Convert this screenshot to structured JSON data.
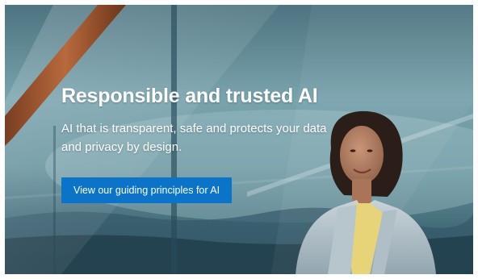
{
  "hero": {
    "headline": "Responsible and trusted AI",
    "subtitle": "AI that is transparent, safe and protects your data and privacy by design.",
    "cta_label": "View our guiding principles for AI"
  },
  "colors": {
    "cta_background": "#0b73c8",
    "text": "#ffffff",
    "sky": "#6d98a3"
  },
  "images": {
    "background": "woman-at-glass-window-photo"
  }
}
